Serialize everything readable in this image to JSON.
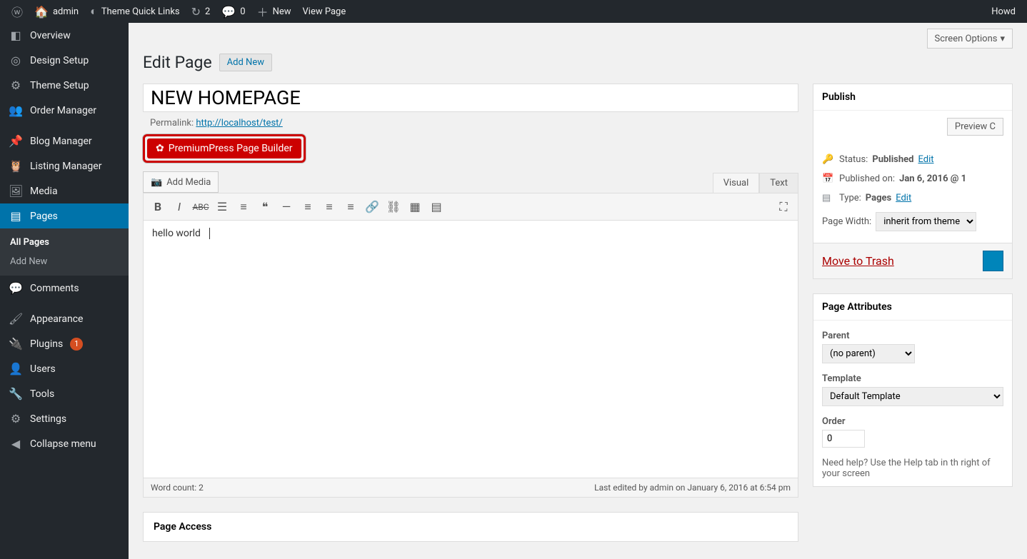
{
  "adminbar": {
    "site": "admin",
    "theme_links": "Theme Quick Links",
    "updates": "2",
    "comments": "0",
    "new": "New",
    "view_page": "View Page",
    "howdy": "Howd"
  },
  "sidebar": {
    "items": [
      {
        "label": "Overview",
        "icon": "◧"
      },
      {
        "label": "Design Setup",
        "icon": "◎"
      },
      {
        "label": "Theme Setup",
        "icon": "⚙"
      },
      {
        "label": "Order Manager",
        "icon": "👥"
      },
      {
        "label": "Blog Manager",
        "icon": "📌"
      },
      {
        "label": "Listing Manager",
        "icon": "👤"
      },
      {
        "label": "Media",
        "icon": "🖼"
      },
      {
        "label": "Pages",
        "icon": "▤"
      },
      {
        "label": "Comments",
        "icon": "💬"
      },
      {
        "label": "Appearance",
        "icon": "🖌"
      },
      {
        "label": "Plugins",
        "icon": "🔌"
      },
      {
        "label": "Users",
        "icon": "👤"
      },
      {
        "label": "Tools",
        "icon": "🔧"
      },
      {
        "label": "Settings",
        "icon": "⚙"
      }
    ],
    "submenu": {
      "all": "All Pages",
      "add": "Add New"
    },
    "collapse": "Collapse menu",
    "plugins_count": "1"
  },
  "header": {
    "screen_options": "Screen Options",
    "title": "Edit Page",
    "add_new": "Add New"
  },
  "editor": {
    "page_title": "NEW HOMEPAGE",
    "permalink_label": "Permalink:",
    "permalink_url": "http://localhost/test/",
    "pp_button": "PremiumPress Page Builder",
    "add_media": "Add Media",
    "tab_visual": "Visual",
    "tab_text": "Text",
    "content": "hello world",
    "word_count": "Word count: 2",
    "last_edited": "Last edited by admin on January 6, 2016 at 6:54 pm"
  },
  "publish": {
    "title": "Publish",
    "preview": "Preview C",
    "status_label": "Status:",
    "status_value": "Published",
    "edit": "Edit",
    "published_label": "Published on:",
    "published_value": "Jan 6, 2016 @ 1",
    "type_label": "Type:",
    "type_value": "Pages",
    "page_width_label": "Page Width:",
    "page_width_value": "inherit from theme",
    "trash": "Move to Trash"
  },
  "attributes": {
    "title": "Page Attributes",
    "parent_label": "Parent",
    "parent_value": "(no parent)",
    "template_label": "Template",
    "template_value": "Default Template",
    "order_label": "Order",
    "order_value": "0",
    "help_text": "Need help? Use the Help tab in th right of your screen"
  },
  "page_access": {
    "title": "Page Access"
  }
}
